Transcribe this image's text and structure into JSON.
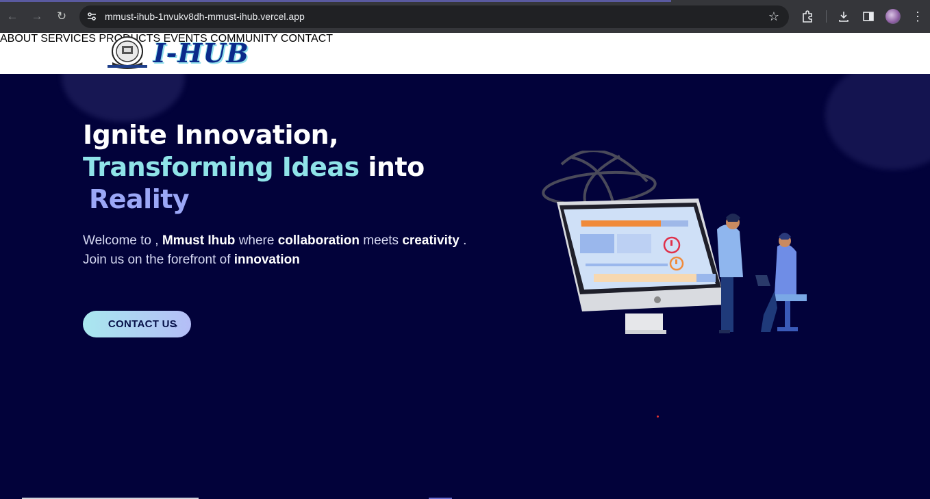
{
  "browser": {
    "url": "mmust-ihub-1nvukv8dh-mmust-ihub.vercel.app",
    "icons": [
      "back-icon",
      "forward-icon",
      "reload-icon",
      "site-settings-icon",
      "bookmark-star-icon",
      "extensions-icon",
      "download-icon",
      "side-panel-icon",
      "profile-avatar",
      "more-menu-icon"
    ]
  },
  "header": {
    "logo_text": "I-HUB",
    "nav": [
      "ABOUT",
      "SERVICES",
      "PRODUCTS",
      "EVENTS",
      "COMMUNITY",
      "CONTACT"
    ]
  },
  "hero": {
    "headline_line1": "Ignite Innovation,",
    "headline_teal": "Transforming Ideas",
    "headline_into": " into",
    "headline_reality": "Reality",
    "sub_welcome": "Welcome to , ",
    "sub_brand": "Mmust Ihub",
    "sub_where": " where ",
    "sub_collab": "collaboration",
    "sub_meets": " meets ",
    "sub_creativity": "creativity",
    "sub_period": " .",
    "sub_join": "Join us on the forefront of ",
    "sub_innovation": "innovation",
    "cta_label": "CONTACT US",
    "cta_arrow": "→"
  },
  "colors": {
    "hero_bg": "#02023a",
    "accent_teal": "#8fe3e8",
    "accent_violet": "#9ba7f7",
    "nav_text": "#1a3ea8"
  }
}
